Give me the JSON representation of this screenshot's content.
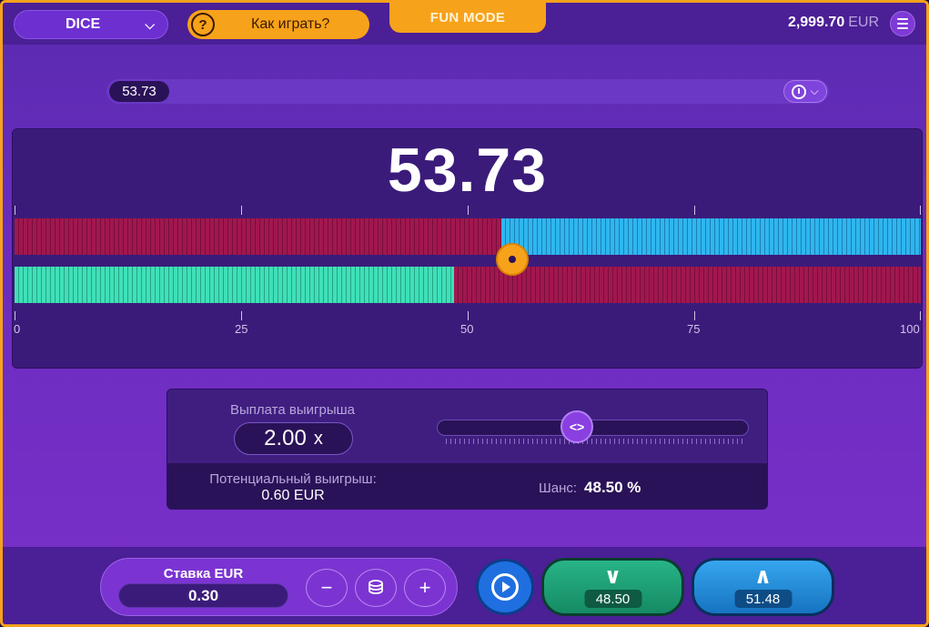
{
  "header": {
    "game_select_label": "DICE",
    "how_to_play_label": "Как играть?",
    "mode_badge": "FUN MODE",
    "balance_amount": "2,999.70",
    "balance_currency": "EUR"
  },
  "history": {
    "last_result": "53.73"
  },
  "game": {
    "result_display": "53.73",
    "result_value": 53.73,
    "threshold_value": 48.5,
    "axis_labels": [
      "0",
      "25",
      "50",
      "75",
      "100"
    ]
  },
  "payout": {
    "title": "Выплата выигрыша",
    "multiplier": "2.00",
    "multiplier_suffix": "x",
    "potential_win_label": "Потенциальный выигрыш:",
    "potential_win_value": "0.60 EUR",
    "chance_label": "Шанс:",
    "chance_value": "48.50 %",
    "slider_handle_glyph": "<>"
  },
  "bet": {
    "label": "Ставка EUR",
    "value": "0.30",
    "minus_label": "−",
    "plus_label": "+"
  },
  "actions": {
    "under_value": "48.50",
    "over_value": "51.48"
  },
  "colors": {
    "accent_orange": "#f7a21b",
    "losing_red": "#a1174f",
    "over_blue": "#2fb6ef",
    "under_teal": "#3fe0b8"
  }
}
